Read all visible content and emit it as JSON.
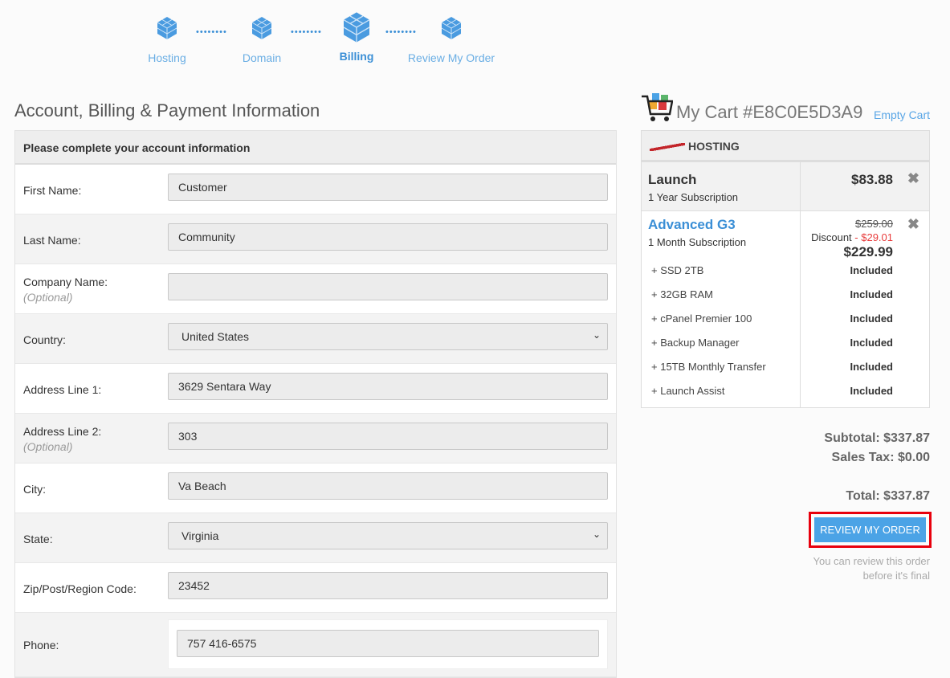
{
  "steps": [
    {
      "label": "Hosting"
    },
    {
      "label": "Domain"
    },
    {
      "label": "Billing"
    },
    {
      "label": "Review My Order"
    }
  ],
  "dots": "••••••••",
  "page_title": "Account, Billing & Payment Information",
  "form": {
    "header": "Please complete your account information",
    "fields": [
      {
        "label": "First Name:",
        "value": "Customer"
      },
      {
        "label": "Last Name:",
        "value": "Community"
      },
      {
        "label": "Company Name:",
        "optional": "(Optional)",
        "value": ""
      },
      {
        "label": "Country:",
        "value": "United States"
      },
      {
        "label": "Address Line 1:",
        "value": "3629 Sentara Way"
      },
      {
        "label": "Address Line 2:",
        "optional": "(Optional)",
        "value": "303"
      },
      {
        "label": "City:",
        "value": "Va Beach"
      },
      {
        "label": "State:",
        "value": "Virginia"
      },
      {
        "label": "Zip/Post/Region Code:",
        "value": "23452"
      },
      {
        "label": "Phone:",
        "value": "757 416-6575"
      }
    ]
  },
  "cart": {
    "title": "My Cart",
    "id": "#E8C0E5D3A9",
    "empty": "Empty Cart",
    "section": "HOSTING",
    "items": [
      {
        "name": "Launch",
        "sub": "1 Year Subscription",
        "price": "$83.88"
      },
      {
        "name": "Advanced G3",
        "sub": "1 Month Subscription",
        "old_price": "$259.00",
        "discount_label": "Discount",
        "discount": "- $29.01",
        "price": "$229.99",
        "features": [
          {
            "name": "SSD 2TB",
            "value": "Included"
          },
          {
            "name": "32GB RAM",
            "value": "Included"
          },
          {
            "name": "cPanel Premier 100",
            "value": "Included"
          },
          {
            "name": "Backup Manager",
            "value": "Included"
          },
          {
            "name": "15TB Monthly Transfer",
            "value": "Included"
          },
          {
            "name": "Launch Assist",
            "value": "Included"
          }
        ]
      }
    ],
    "subtotal": "Subtotal: $337.87",
    "tax": "Sales Tax: $0.00",
    "total": "Total: $337.87",
    "button": "REVIEW MY ORDER",
    "note1": "You can review this order",
    "note2": "before it's final"
  },
  "colors": {
    "accent": "#4ba3e6",
    "highlight": "#e8000d",
    "discount": "#e83a3a"
  }
}
